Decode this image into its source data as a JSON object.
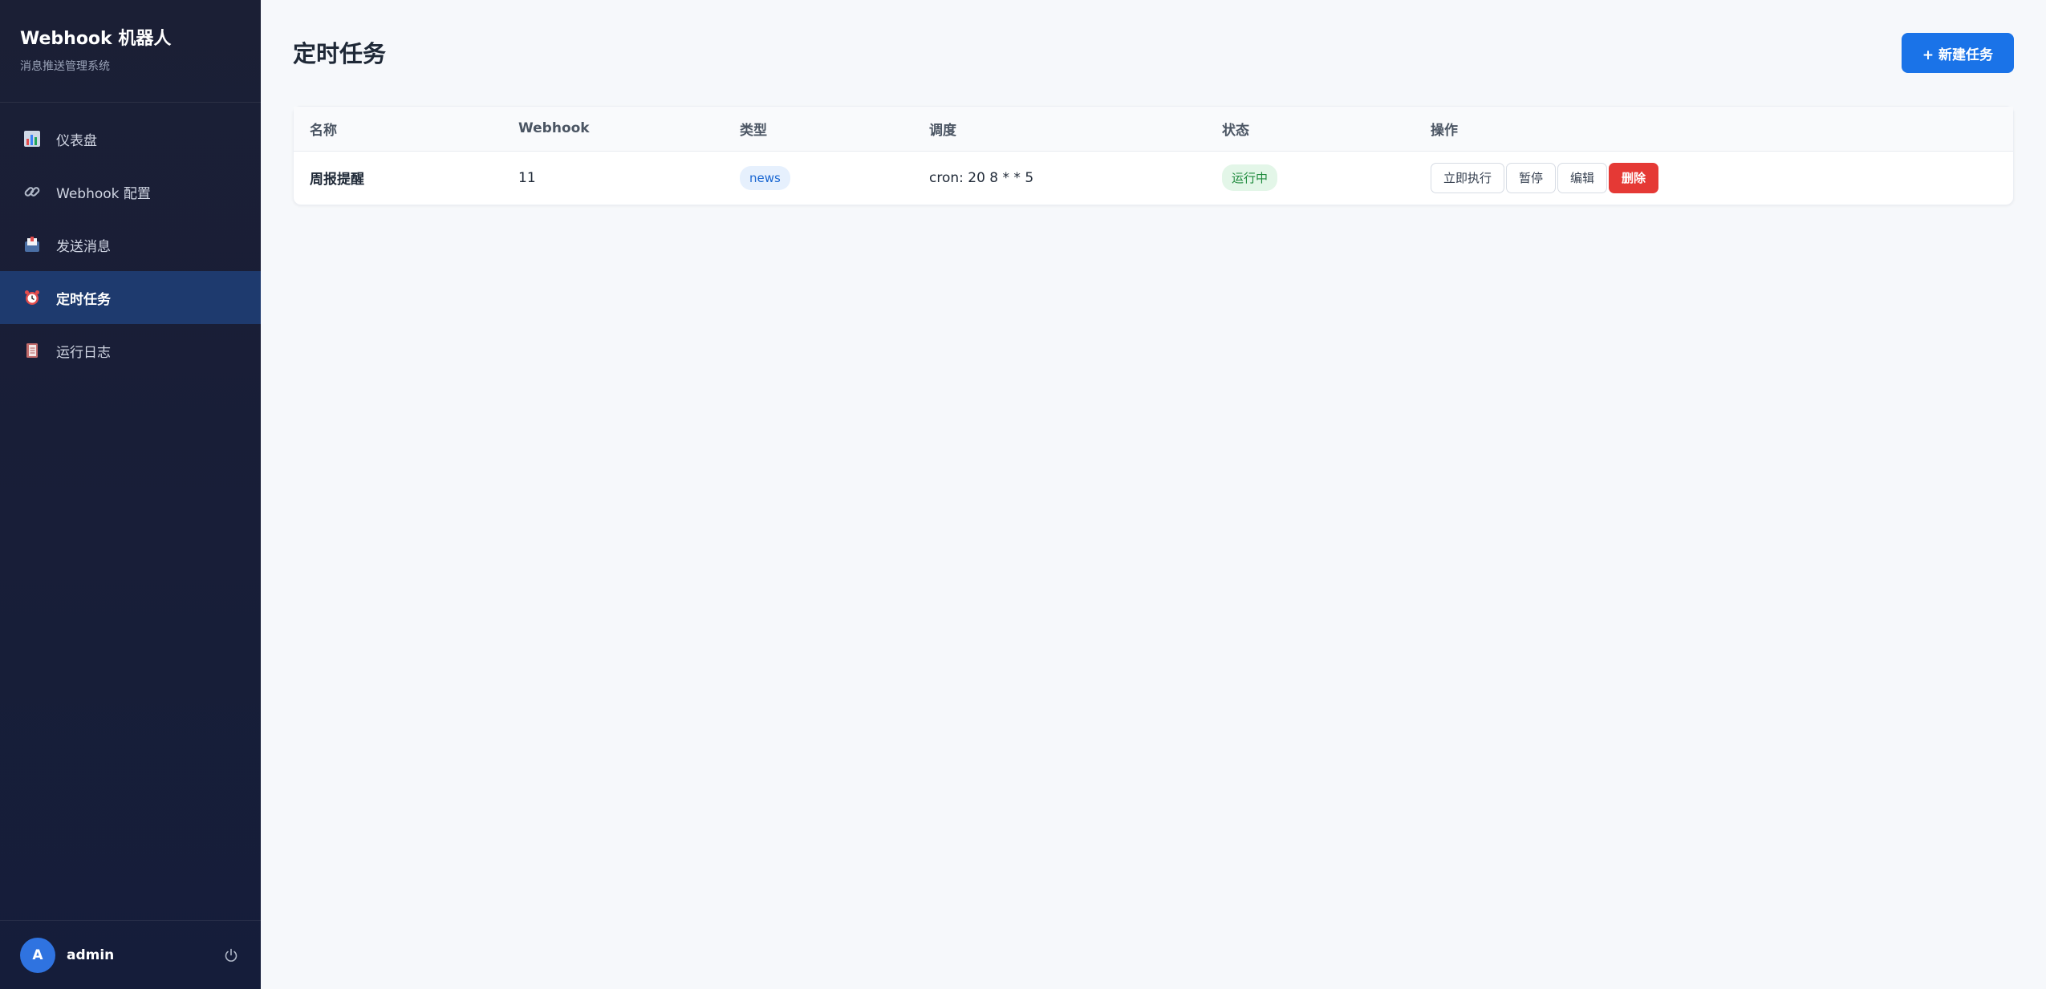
{
  "app": {
    "title": "Webhook 机器人",
    "subtitle": "消息推送管理系统"
  },
  "sidebar": {
    "items": [
      {
        "label": "仪表盘",
        "icon": "chart-icon"
      },
      {
        "label": "Webhook 配置",
        "icon": "link-icon"
      },
      {
        "label": "发送消息",
        "icon": "inbox-icon"
      },
      {
        "label": "定时任务",
        "icon": "alarm-clock-icon",
        "active": true
      },
      {
        "label": "运行日志",
        "icon": "notebook-icon"
      }
    ]
  },
  "user": {
    "avatar_letter": "A",
    "name": "admin"
  },
  "page": {
    "title": "定时任务",
    "new_button": "+ 新建任务"
  },
  "table": {
    "headers": [
      "名称",
      "Webhook",
      "类型",
      "调度",
      "状态",
      "操作"
    ],
    "rows": [
      {
        "name": "周报提醒",
        "webhook": "11",
        "type": "news",
        "schedule": "cron: 20 8 * * 5",
        "status": "运行中",
        "actions": {
          "run": "立即执行",
          "pause": "暂停",
          "edit": "编辑",
          "delete": "删除"
        }
      }
    ]
  },
  "colors": {
    "sidebar_bg": "#1b1f35",
    "active_bg": "#1e3a6e",
    "primary": "#1a73e8",
    "danger": "#e53935",
    "status_ok": "#1e8a3c"
  }
}
